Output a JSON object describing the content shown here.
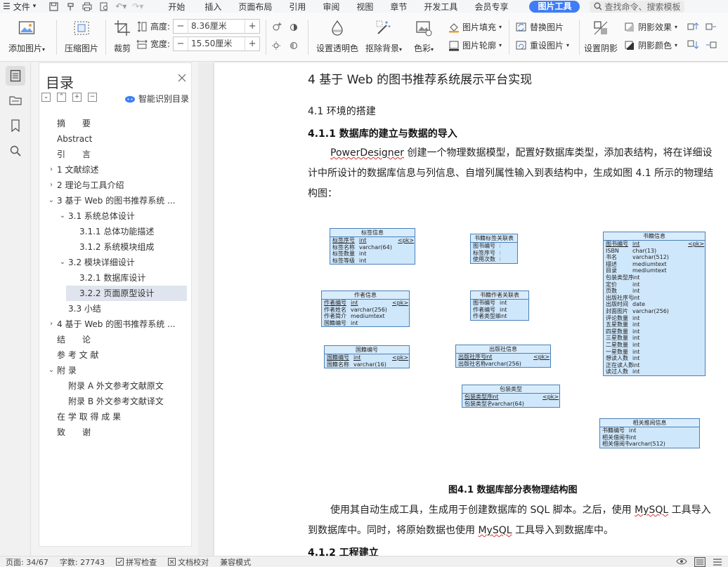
{
  "menubar": {
    "file_label": "文件",
    "tabs": [
      "开始",
      "插入",
      "页面布局",
      "引用",
      "审阅",
      "视图",
      "章节",
      "开发工具",
      "会员专享"
    ],
    "active_tab": "图片工具",
    "search_placeholder": "查找命令、搜索模板"
  },
  "ribbon": {
    "add_picture": "添加图片",
    "compress_picture": "压缩图片",
    "crop": "裁剪",
    "height_label": "高度:",
    "height_value": "8.36厘米",
    "width_label": "宽度:",
    "width_value": "15.50厘米",
    "set_transparent": "设置透明色",
    "remove_bg": "抠除背景",
    "color": "色彩",
    "picture_fill": "图片填充",
    "picture_outline": "图片轮廓",
    "replace_picture": "替换图片",
    "reset_size": "重设图片",
    "set_shadow": "设置阴影",
    "shadow_effect": "阴影效果",
    "shadow_color": "阴影颜色",
    "minus": "−",
    "plus": "+"
  },
  "toc": {
    "title": "目录",
    "smart_label": "智能识别目录",
    "items": [
      {
        "label": "摘　　要"
      },
      {
        "label": "Abstract"
      },
      {
        "label": "引　　言"
      },
      {
        "label": "1 文献综述"
      },
      {
        "label": "2 理论与工具介绍"
      },
      {
        "label": "3  基于 Web 的图书推荐系统 ..."
      },
      {
        "label": "3.1  系统总体设计"
      },
      {
        "label": "3.1.1  总体功能描述"
      },
      {
        "label": "3.1.2  系统模块组成"
      },
      {
        "label": "3.2  模块详细设计"
      },
      {
        "label": "3.2.1  数据库设计"
      },
      {
        "label": "3.2.2  页面原型设计"
      },
      {
        "label": "3.3  小结"
      },
      {
        "label": "4  基于 Web 的图书推荐系统 ..."
      },
      {
        "label": "结　　论"
      },
      {
        "label": "参 考 文 献"
      },
      {
        "label": "附  录"
      },
      {
        "label": "附录 A  外文参考文献原文"
      },
      {
        "label": "附录 B  外文参考文献译文"
      },
      {
        "label": "在 学 取 得 成 果"
      },
      {
        "label": "致　　谢"
      }
    ]
  },
  "doc": {
    "h1": "4  基于 Web 的图书推荐系统展示平台实现",
    "h2": "4.1  环境的搭建",
    "h3": "4.1.1 数据库的建立与数据的导入",
    "p1_a": "PowerDesigner",
    "p1_b": " 创建一个物理数据模型，配置好数据库类型，添加表结构，将在详细设计中所设计的数据库信息与列信息、自增列属性输入到表结构中，生成如图 4.1 所示的物理结构图：",
    "caption": "图4.1  数据库部分表物理结构图",
    "p2_a": "使用其自动生成工具，生成用于创建数据库的 SQL 脚本。之后，使用 ",
    "p2_b": "MySQL",
    "p2_c": " 工具导入到数据库中。同时，将原始数据也使用 ",
    "p2_d": "MySQL",
    "p2_e": " 工具导入到数据库中。",
    "h3b": "4.1.2 工程建立"
  },
  "er_tables": [
    {
      "title": "标签信息",
      "rows": [
        [
          "标签序号",
          "int",
          "<pk>"
        ],
        [
          "标签名称",
          "varchar(64)",
          ""
        ],
        [
          "标签数量",
          "int",
          ""
        ],
        [
          "标签等级",
          "int",
          ""
        ]
      ]
    },
    {
      "title": "书籍标签关联表",
      "rows": [
        [
          "图书编号",
          "int",
          ""
        ],
        [
          "标签序号",
          "int",
          ""
        ],
        [
          "使用次数",
          "int",
          ""
        ]
      ]
    },
    {
      "title": "书籍信息",
      "rows": [
        [
          "图书编号",
          "int",
          "<pk>"
        ],
        [
          "ISBN",
          "char(13)",
          ""
        ],
        [
          "书名",
          "varchar(512)",
          ""
        ],
        [
          "描述",
          "mediumtext",
          ""
        ],
        [
          "目录",
          "mediumtext",
          ""
        ],
        [
          "包装类型序号",
          "int",
          ""
        ],
        [
          "定价",
          "int",
          ""
        ],
        [
          "页数",
          "int",
          ""
        ],
        [
          "出版社序号",
          "int",
          ""
        ],
        [
          "出版时间",
          "date",
          ""
        ],
        [
          "封面图片",
          "varchar(256)",
          ""
        ],
        [
          "评论数量",
          "int",
          ""
        ],
        [
          "五星数量",
          "int",
          ""
        ],
        [
          "四星数量",
          "int",
          ""
        ],
        [
          "三星数量",
          "int",
          ""
        ],
        [
          "二星数量",
          "int",
          ""
        ],
        [
          "一星数量",
          "int",
          ""
        ],
        [
          "想读人数",
          "int",
          ""
        ],
        [
          "正在读人数",
          "int",
          ""
        ],
        [
          "读过人数",
          "int",
          ""
        ]
      ]
    },
    {
      "title": "作者信息",
      "rows": [
        [
          "作者编号",
          "int",
          "<pk>"
        ],
        [
          "作者姓名",
          "varchar(256)",
          ""
        ],
        [
          "作者简介",
          "mediumtext",
          ""
        ],
        [
          "国籍编号",
          "int",
          ""
        ]
      ]
    },
    {
      "title": "书籍作者关联表",
      "rows": [
        [
          "图书编号",
          "int",
          ""
        ],
        [
          "作者编号",
          "int",
          ""
        ],
        [
          "作者类型编号",
          "int",
          ""
        ]
      ]
    },
    {
      "title": "国籍编号",
      "rows": [
        [
          "国籍编号",
          "int",
          "<pk>"
        ],
        [
          "国籍名称",
          "varchar(16)",
          ""
        ]
      ]
    },
    {
      "title": "出版社信息",
      "rows": [
        [
          "出版社序号",
          "int",
          "<pk>"
        ],
        [
          "出版社名称",
          "varchar(256)",
          ""
        ]
      ]
    },
    {
      "title": "包装类型",
      "rows": [
        [
          "包装类型序号",
          "int",
          "<pk>"
        ],
        [
          "包装类型名称",
          "varchar(64)",
          ""
        ]
      ]
    },
    {
      "title": "相关推阅信息",
      "rows": [
        [
          "书籍编号",
          "int",
          ""
        ],
        [
          "相关借阅书籍编号",
          "int",
          ""
        ],
        [
          "相关借阅书籍名称",
          "varchar(512)",
          ""
        ]
      ]
    }
  ],
  "status": {
    "page": "页面: 34/67",
    "words": "字数: 27743",
    "spell": "拼写检查",
    "proof": "文档校对",
    "compat": "兼容模式"
  },
  "colors": {
    "accent": "#3f7df6",
    "er_fill": "#cfe7fb",
    "er_border": "#4a80b8",
    "toc_selected": "#dfe4ee"
  }
}
